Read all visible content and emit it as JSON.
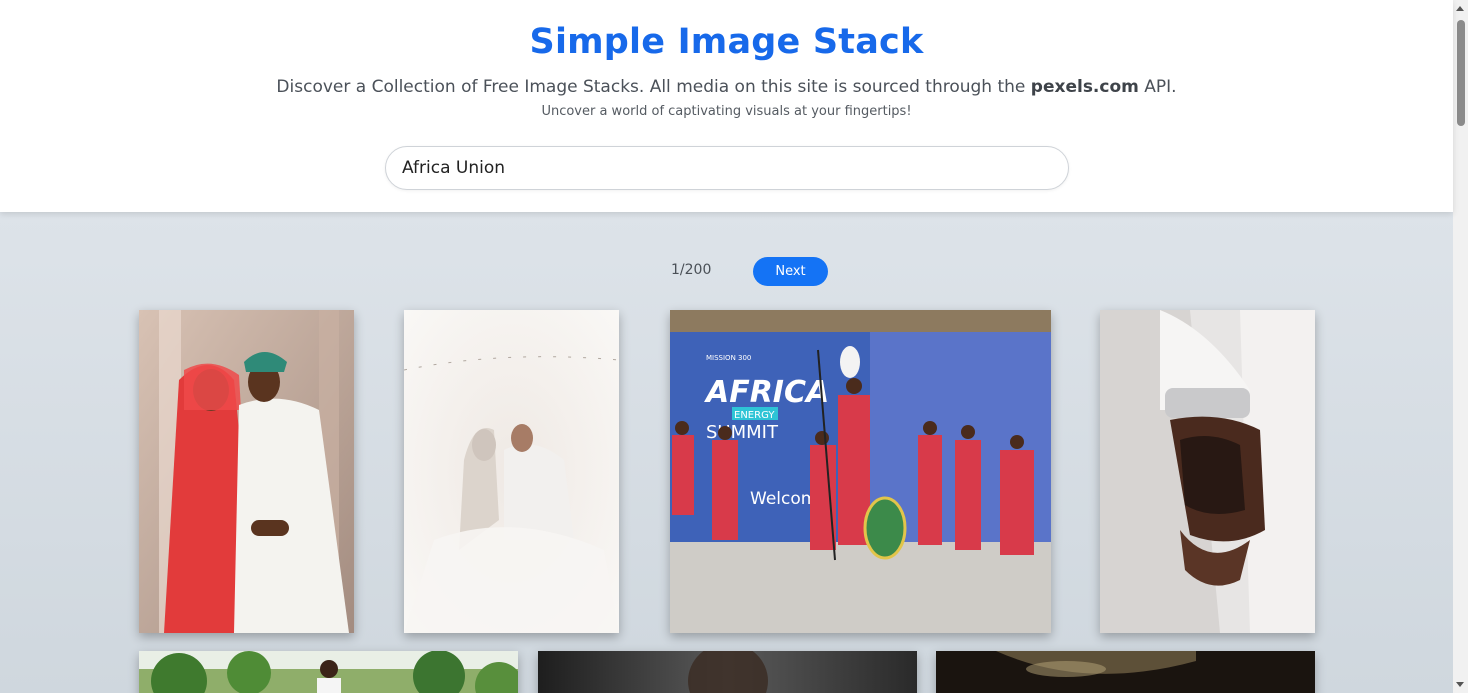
{
  "header": {
    "title": "Simple Image Stack",
    "tagline_prefix": "Discover a Collection of Free Image Stacks. All media on this site is sourced through the ",
    "tagline_brand": "pexels.com",
    "tagline_suffix": " API.",
    "subtitle": "Uncover a world of captivating visuals at your fingertips!"
  },
  "search": {
    "value": "Africa Union"
  },
  "pagination": {
    "page_label": "1/200",
    "next_label": "Next"
  },
  "photos": [
    {
      "name": "couple-traditional-wedding",
      "banner_line1": "",
      "banner_line2": "",
      "banner_line3": ""
    },
    {
      "name": "bride-groom-soft-focus",
      "banner_line1": "",
      "banner_line2": "",
      "banner_line3": ""
    },
    {
      "name": "africa-energy-summit-dancers",
      "banner_top": "MISSION 300",
      "banner_line1": "AFRICA",
      "banner_line2": "ENERGY",
      "banner_line3": "SUMMIT",
      "banner_welcome": "Welcome"
    },
    {
      "name": "henna-hands-bracelet"
    },
    {
      "name": "man-in-garden"
    },
    {
      "name": "dark-portrait"
    },
    {
      "name": "dark-detail"
    }
  ],
  "colors": {
    "accent": "#1769ea",
    "button": "#1473f5"
  }
}
